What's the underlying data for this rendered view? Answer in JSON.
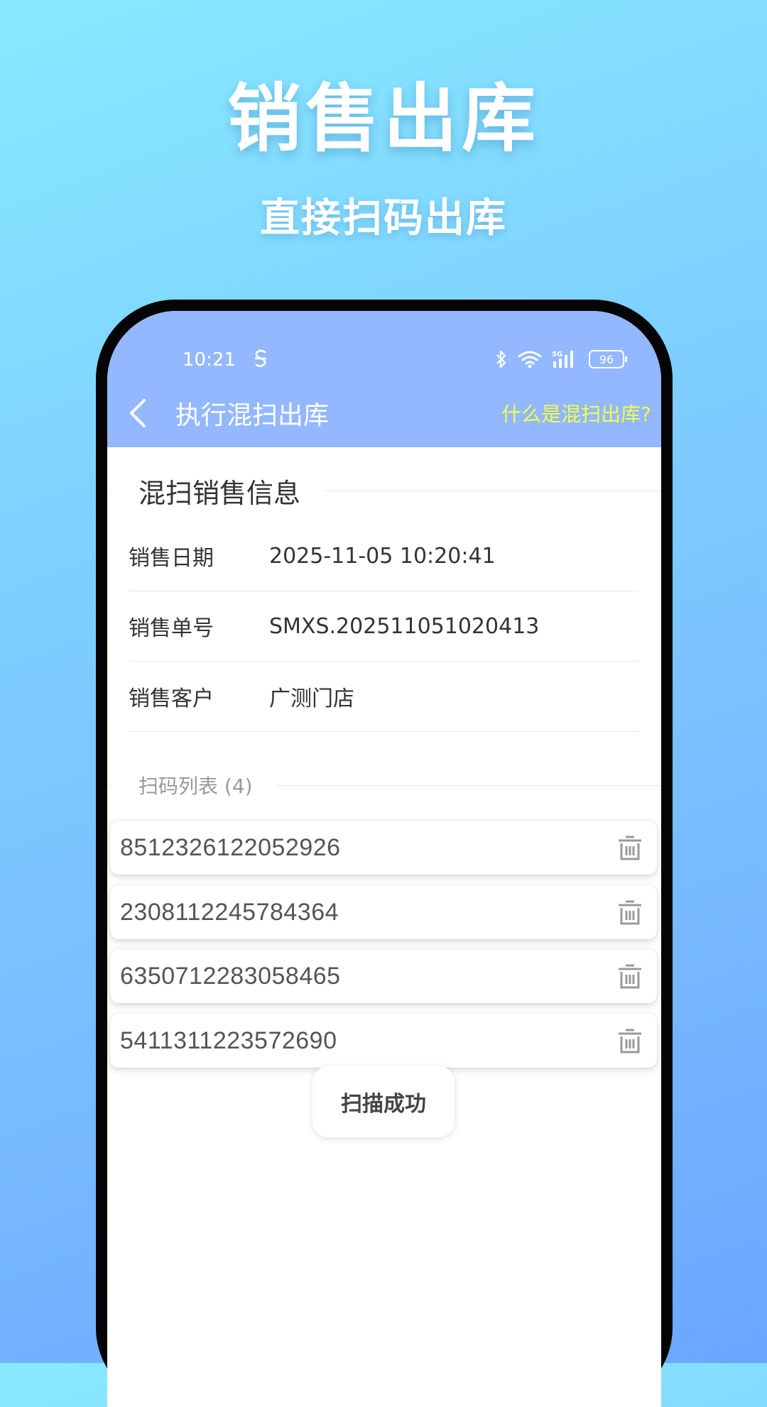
{
  "promo": {
    "title": "销售出库",
    "subtitle": "直接扫码出库"
  },
  "status_bar": {
    "time": "10:21",
    "network": "5G",
    "battery": "96"
  },
  "app_bar": {
    "title": "执行混扫出库",
    "help_link": "什么是混扫出库?"
  },
  "info": {
    "section_title": "混扫销售信息",
    "rows": [
      {
        "label": "销售日期",
        "value": "2025-11-05 10:20:41"
      },
      {
        "label": "销售单号",
        "value": "SMXS.202511051020413"
      },
      {
        "label": "销售客户",
        "value": "广测门店"
      }
    ]
  },
  "scan_list": {
    "title": "扫码列表 (4)",
    "items": [
      {
        "code": "8512326122052926"
      },
      {
        "code": "2308112245784364"
      },
      {
        "code": "6350712283058465"
      },
      {
        "code": "5411311223572690"
      }
    ]
  },
  "toast": {
    "message": "扫描成功"
  },
  "colors": {
    "header": "#93b8ff",
    "help_link": "#f1ff4a",
    "frame": "#050505"
  },
  "icons": [
    "back-arrow-icon",
    "bluetooth-icon",
    "wifi-icon",
    "signal-icon",
    "battery-icon",
    "trash-icon"
  ]
}
